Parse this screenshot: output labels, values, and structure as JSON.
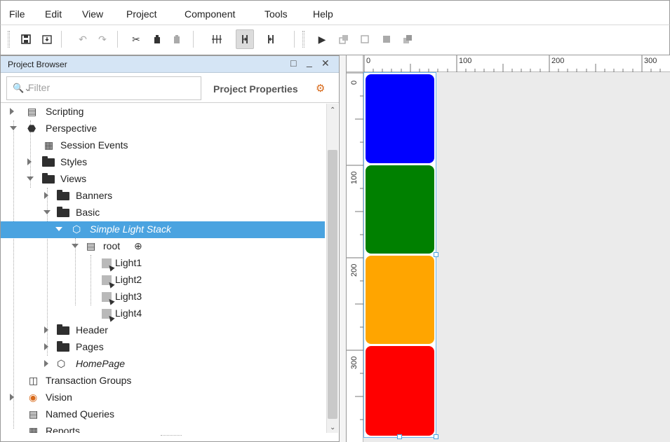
{
  "menu": [
    "File",
    "Edit",
    "View",
    "Project",
    "Component",
    "Tools",
    "Help"
  ],
  "toolbar": {
    "icons": [
      "save-icon",
      "save-all-icon",
      "undo-icon",
      "redo-icon",
      "cut-icon",
      "copy-icon",
      "paste-icon",
      "align-icon",
      "distribute-icon",
      "align-vertical-icon",
      "play-icon",
      "group-icon",
      "ungroup-icon",
      "bring-front-icon",
      "send-back-icon"
    ]
  },
  "panel": {
    "title": "Project Browser",
    "filter_placeholder": "Filter",
    "project_properties": "Project Properties"
  },
  "tree": {
    "scripting": "Scripting",
    "perspective": "Perspective",
    "session_events": "Session Events",
    "styles": "Styles",
    "views": "Views",
    "banners": "Banners",
    "basic": "Basic",
    "simple_light_stack": "Simple Light Stack",
    "root": "root",
    "light1": "Light1",
    "light2": "Light2",
    "light3": "Light3",
    "light4": "Light4",
    "header": "Header",
    "pages": "Pages",
    "homepage": "HomePage",
    "transaction_groups": "Transaction Groups",
    "vision": "Vision",
    "named_queries": "Named Queries",
    "reports": "Reports"
  },
  "ruler": {
    "top": [
      "0",
      "100",
      "200",
      "300"
    ],
    "left": [
      "0",
      "100",
      "200",
      "300"
    ]
  },
  "lights": [
    {
      "name": "Light1",
      "color": "#0000ff"
    },
    {
      "name": "Light2",
      "color": "#008000"
    },
    {
      "name": "Light3",
      "color": "#ffa500"
    },
    {
      "name": "Light4",
      "color": "#ff0000"
    }
  ]
}
